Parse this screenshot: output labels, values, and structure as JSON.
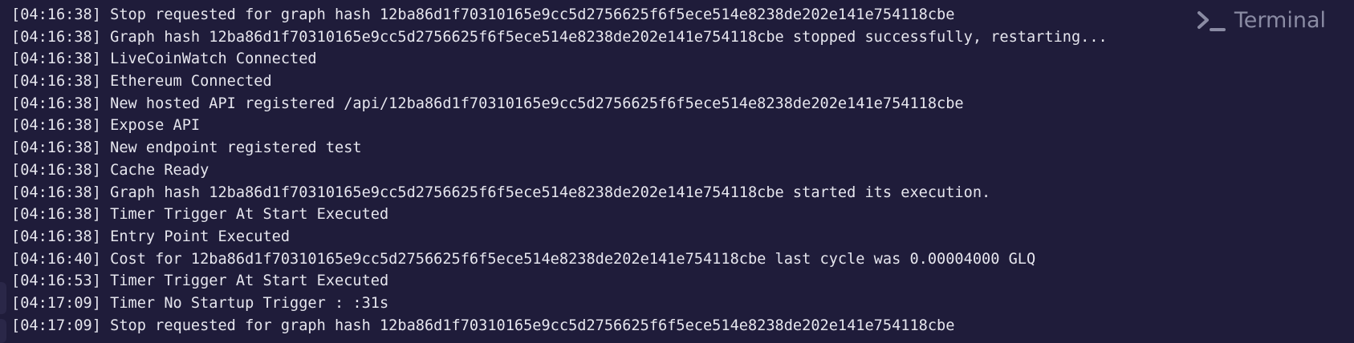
{
  "panel": {
    "title": "Terminal",
    "icon": "terminal-icon"
  },
  "lines": [
    {
      "time": "[04:16:38]",
      "message": "Stop requested for graph hash 12ba86d1f70310165e9cc5d2756625f6f5ece514e8238de202e141e754118cbe"
    },
    {
      "time": "[04:16:38]",
      "message": "Graph hash 12ba86d1f70310165e9cc5d2756625f6f5ece514e8238de202e141e754118cbe stopped successfully, restarting..."
    },
    {
      "time": "[04:16:38]",
      "message": "LiveCoinWatch Connected"
    },
    {
      "time": "[04:16:38]",
      "message": "Ethereum Connected"
    },
    {
      "time": "[04:16:38]",
      "message": "New hosted API registered /api/12ba86d1f70310165e9cc5d2756625f6f5ece514e8238de202e141e754118cbe"
    },
    {
      "time": "[04:16:38]",
      "message": "Expose API"
    },
    {
      "time": "[04:16:38]",
      "message": "New endpoint registered test"
    },
    {
      "time": "[04:16:38]",
      "message": "Cache Ready"
    },
    {
      "time": "[04:16:38]",
      "message": "Graph hash 12ba86d1f70310165e9cc5d2756625f6f5ece514e8238de202e141e754118cbe started its execution."
    },
    {
      "time": "[04:16:38]",
      "message": "Timer Trigger At Start Executed"
    },
    {
      "time": "[04:16:38]",
      "message": "Entry Point Executed"
    },
    {
      "time": "[04:16:40]",
      "message": "Cost for 12ba86d1f70310165e9cc5d2756625f6f5ece514e8238de202e141e754118cbe last cycle was 0.00004000 GLQ"
    },
    {
      "time": "[04:16:53]",
      "message": "Timer Trigger At Start Executed"
    },
    {
      "time": "[04:17:09]",
      "message": "Timer No Startup Trigger : :31s"
    },
    {
      "time": "[04:17:09]",
      "message": "Stop requested for graph hash 12ba86d1f70310165e9cc5d2756625f6f5ece514e8238de202e141e754118cbe"
    }
  ],
  "colors": {
    "background": "#1f1c3a",
    "text": "#e6e6ee",
    "title": "#8a8ba3"
  }
}
